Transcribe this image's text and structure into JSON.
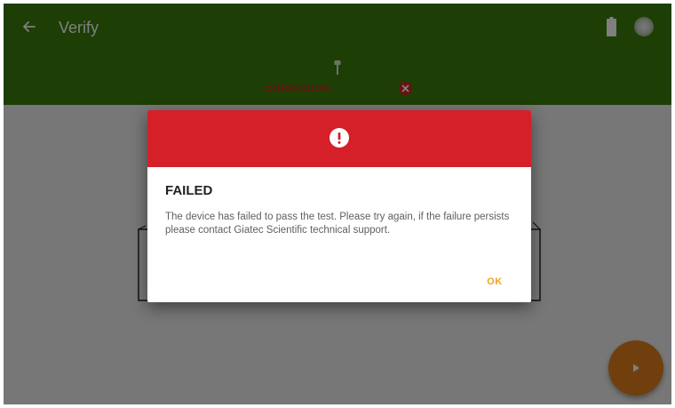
{
  "appbar": {
    "title": "Verify",
    "back_icon": "arrow-left-icon",
    "battery_icon": "battery-icon",
    "status_icon": "connection-status-icon",
    "background_color": "#3b7d0a"
  },
  "test": {
    "label": "CORROSION",
    "probe_icon": "probe-icon",
    "result_icon": "fail-icon",
    "label_color": "#d9231f"
  },
  "dialog": {
    "header_icon": "alert-icon",
    "header_color": "#d52029",
    "title": "FAILED",
    "message": "The device has failed to pass the test. Please try again, if the failure persists please contact Giatec Scientific technical support.",
    "ok_label": "OK",
    "ok_color": "#f0a21f"
  },
  "fab": {
    "icon": "play-icon",
    "color": "#e07f1a"
  }
}
